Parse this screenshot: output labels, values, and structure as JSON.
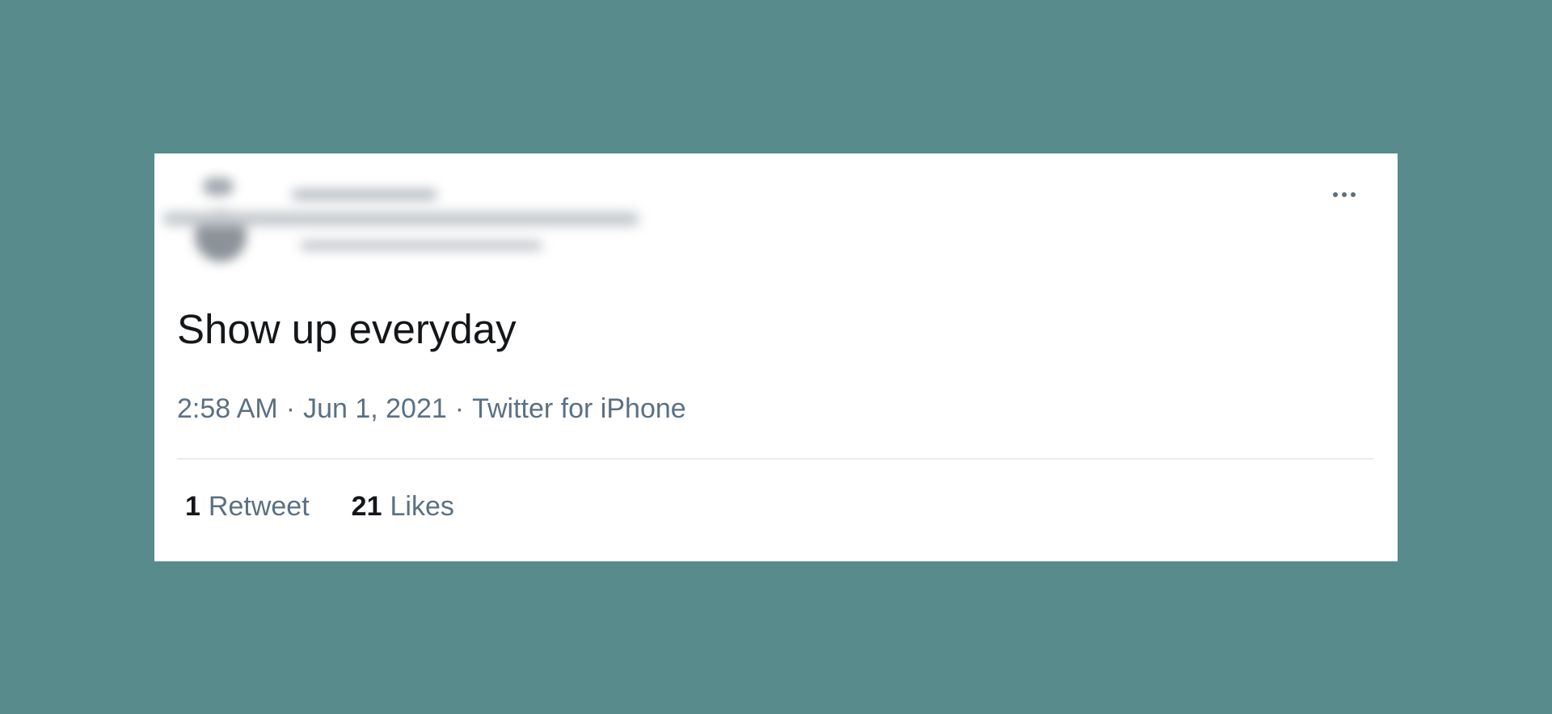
{
  "tweet": {
    "text": "Show up everyday",
    "time": "2:58 AM",
    "separator": "·",
    "date": "Jun 1, 2021",
    "source": "Twitter for iPhone",
    "more_icon": "ellipsis-icon"
  },
  "stats": {
    "retweet_count": "1",
    "retweet_label": "Retweet",
    "like_count": "21",
    "like_label": "Likes"
  },
  "colors": {
    "background": "#588b8b",
    "card": "#ffffff",
    "text_primary": "#14171a",
    "text_secondary": "#5b7083",
    "divider": "#e6ecf0"
  }
}
